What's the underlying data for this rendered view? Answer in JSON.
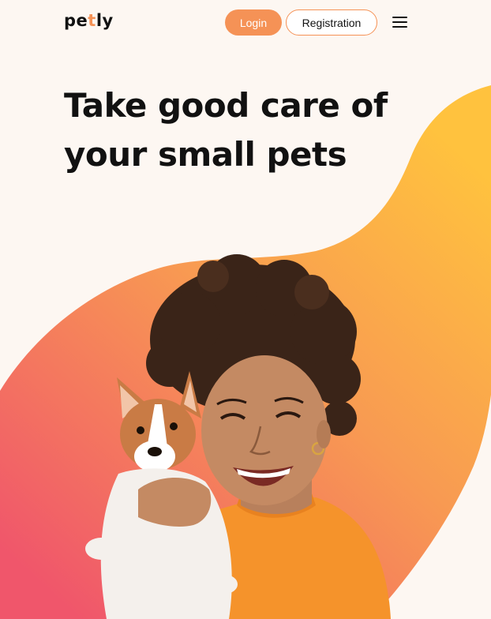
{
  "header": {
    "logo_prefix": "pe",
    "logo_accent": "t",
    "logo_suffix": "ly",
    "login_label": "Login",
    "register_label": "Registration",
    "menu_icon": "hamburger-menu-icon"
  },
  "hero": {
    "title_line1": "Take good care of",
    "title_line2": "your small pets"
  },
  "colors": {
    "accent": "#F59256",
    "background": "#FDF7F2",
    "text": "#111111",
    "blob_top": "#FFC23E",
    "blob_mid": "#F89A52",
    "blob_bottom": "#F0566B"
  }
}
